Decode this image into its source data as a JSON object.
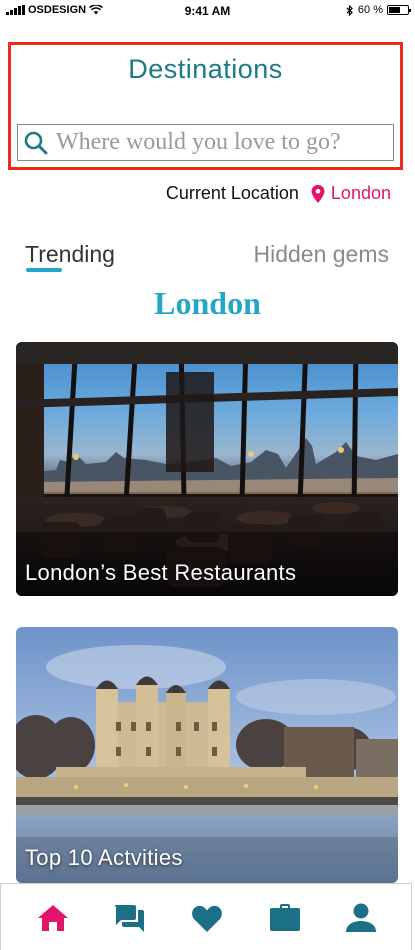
{
  "status_bar": {
    "carrier": "OSDESIGN",
    "time": "9:41 AM",
    "battery_percent": "60 %",
    "battery_level": 0.6
  },
  "header": {
    "title": "Destinations"
  },
  "search": {
    "placeholder": "Where would you love to go?"
  },
  "location": {
    "label": "Current Location",
    "value": "London"
  },
  "tabs": [
    {
      "label": "Trending",
      "active": true
    },
    {
      "label": "Hidden gems",
      "active": false
    }
  ],
  "city_title": "London",
  "cards": [
    {
      "title": "London’s Best Restaurants",
      "image": "restaurant-interior-city-view"
    },
    {
      "title": "Top 10 Actvities",
      "image": "tower-of-london"
    }
  ],
  "bottom_nav": [
    {
      "icon": "home-icon",
      "active": true
    },
    {
      "icon": "chat-icon",
      "active": false
    },
    {
      "icon": "heart-icon",
      "active": false
    },
    {
      "icon": "briefcase-icon",
      "active": false
    },
    {
      "icon": "person-icon",
      "active": false
    }
  ],
  "colors": {
    "brand_teal": "#1b7b86",
    "accent_cyan": "#23a7c6",
    "accent_pink": "#e0156b",
    "nav_inactive": "#1b6f86",
    "highlight_border": "#ee2a1d"
  }
}
